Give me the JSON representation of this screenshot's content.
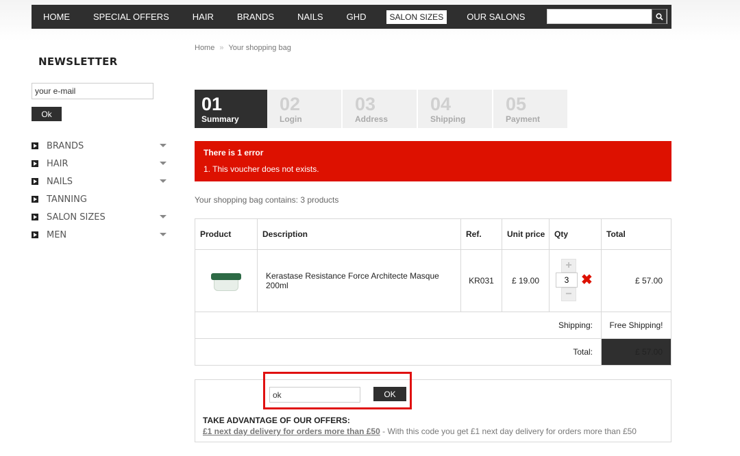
{
  "nav": {
    "items": [
      {
        "label": "HOME",
        "active": false
      },
      {
        "label": "SPECIAL OFFERS",
        "active": false
      },
      {
        "label": "HAIR",
        "active": false
      },
      {
        "label": "BRANDS",
        "active": false
      },
      {
        "label": "NAILS",
        "active": false
      },
      {
        "label": "GHD",
        "active": false
      },
      {
        "label": "SALON SIZES",
        "active": true
      },
      {
        "label": "OUR SALONS",
        "active": false
      }
    ],
    "search_value": ""
  },
  "sidebar": {
    "newsletter_title": "NEWSLETTER",
    "newsletter_value": "your e-mail",
    "newsletter_button": "Ok",
    "menu": [
      {
        "label": "BRANDS",
        "has_caret": true
      },
      {
        "label": "HAIR",
        "has_caret": true
      },
      {
        "label": "NAILS",
        "has_caret": true
      },
      {
        "label": "TANNING",
        "has_caret": false
      },
      {
        "label": "SALON SIZES",
        "has_caret": true
      },
      {
        "label": "MEN",
        "has_caret": true
      }
    ]
  },
  "breadcrumb": {
    "home": "Home",
    "separator": "»",
    "current": "Your shopping bag"
  },
  "steps": [
    {
      "num": "01",
      "label": "Summary",
      "active": true
    },
    {
      "num": "02",
      "label": "Login",
      "active": false
    },
    {
      "num": "03",
      "label": "Address",
      "active": false
    },
    {
      "num": "04",
      "label": "Shipping",
      "active": false
    },
    {
      "num": "05",
      "label": "Payment",
      "active": false
    }
  ],
  "error": {
    "title": "There is 1 error",
    "message": "1.  This voucher does not exists."
  },
  "bag_count": "Your shopping bag contains: 3 products",
  "cart": {
    "headers": {
      "product": "Product",
      "description": "Description",
      "ref": "Ref.",
      "unit_price": "Unit price",
      "qty": "Qty",
      "total": "Total"
    },
    "item": {
      "description": "Kerastase Resistance Force Architecte Masque 200ml",
      "ref": "KR031",
      "unit_price": "£ 19.00",
      "qty": "3",
      "total": "£ 57.00"
    },
    "shipping_label": "Shipping:",
    "shipping_value": "Free Shipping!",
    "total_label": "Total:",
    "total_value": "£ 57.00"
  },
  "voucher": {
    "value": "ok",
    "button": "OK",
    "offers_title": "TAKE ADVANTAGE OF OUR OFFERS:",
    "offer_link": "£1 next day delivery for orders more than £50",
    "offer_desc": " - With this code you get £1 next day delivery for orders more than £50"
  },
  "colors": {
    "dark": "#2f2f2f",
    "error": "#dd1100",
    "highlight": "#e01010"
  }
}
